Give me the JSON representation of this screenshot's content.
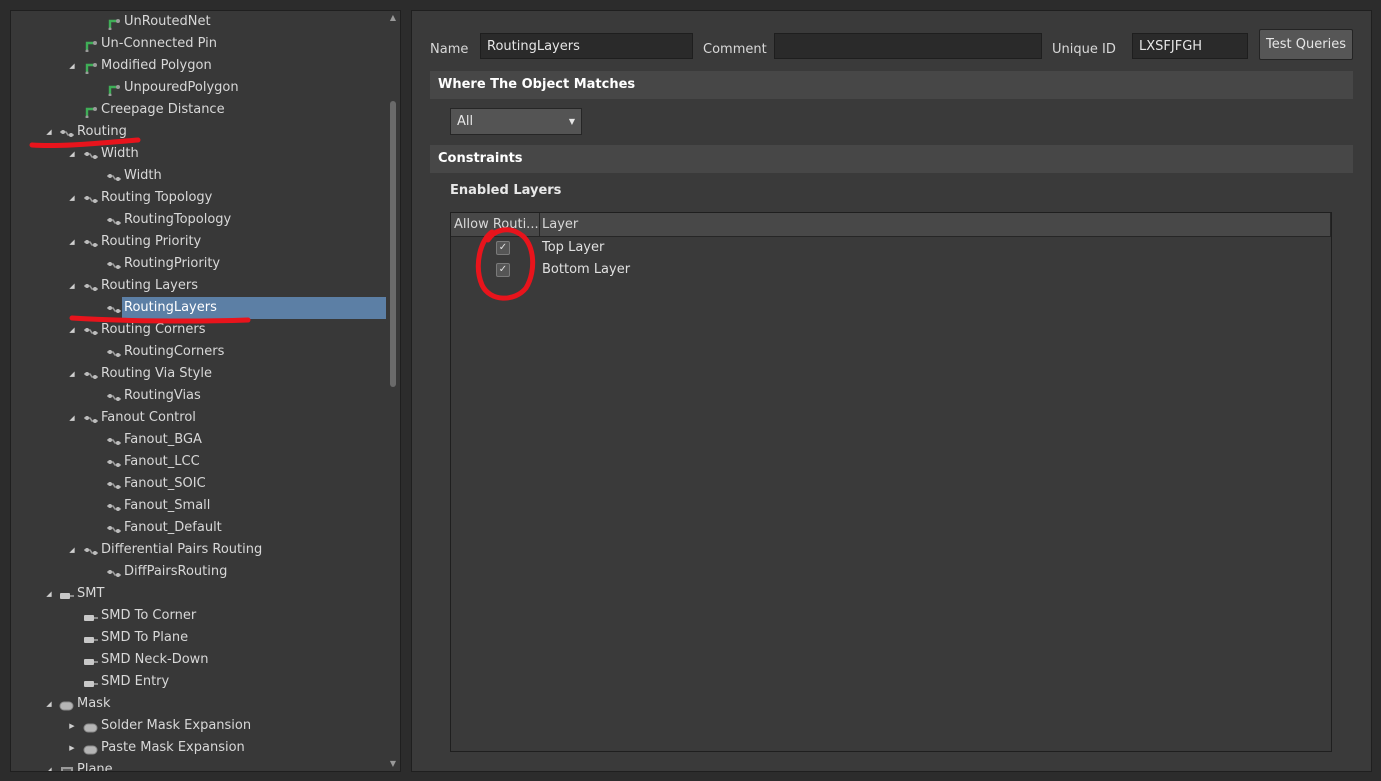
{
  "tree": {
    "items": [
      {
        "label": "UnRoutedNet",
        "depth": 3,
        "icon": "green-rule-icon",
        "arrow": ""
      },
      {
        "label": "Un-Connected Pin",
        "depth": 2,
        "icon": "green-rule-icon",
        "arrow": ""
      },
      {
        "label": "Modified Polygon",
        "depth": 2,
        "icon": "green-rule-icon",
        "arrow": "expanded"
      },
      {
        "label": "UnpouredPolygon",
        "depth": 3,
        "icon": "green-rule-icon",
        "arrow": ""
      },
      {
        "label": "Creepage Distance",
        "depth": 2,
        "icon": "green-rule-icon",
        "arrow": ""
      },
      {
        "label": "Routing",
        "depth": 1,
        "icon": "routing-rule-icon",
        "arrow": "expanded"
      },
      {
        "label": "Width",
        "depth": 2,
        "icon": "routing-rule-icon",
        "arrow": "expanded"
      },
      {
        "label": "Width",
        "depth": 3,
        "icon": "routing-rule-icon",
        "arrow": ""
      },
      {
        "label": "Routing Topology",
        "depth": 2,
        "icon": "routing-rule-icon",
        "arrow": "expanded"
      },
      {
        "label": "RoutingTopology",
        "depth": 3,
        "icon": "routing-rule-icon",
        "arrow": ""
      },
      {
        "label": "Routing Priority",
        "depth": 2,
        "icon": "routing-rule-icon",
        "arrow": "expanded"
      },
      {
        "label": "RoutingPriority",
        "depth": 3,
        "icon": "routing-rule-icon",
        "arrow": ""
      },
      {
        "label": "Routing Layers",
        "depth": 2,
        "icon": "routing-rule-icon",
        "arrow": "expanded"
      },
      {
        "label": "RoutingLayers",
        "depth": 3,
        "icon": "routing-rule-icon",
        "arrow": "",
        "selected": true
      },
      {
        "label": "Routing Corners",
        "depth": 2,
        "icon": "routing-rule-icon",
        "arrow": "expanded"
      },
      {
        "label": "RoutingCorners",
        "depth": 3,
        "icon": "routing-rule-icon",
        "arrow": ""
      },
      {
        "label": "Routing Via Style",
        "depth": 2,
        "icon": "routing-rule-icon",
        "arrow": "expanded"
      },
      {
        "label": "RoutingVias",
        "depth": 3,
        "icon": "routing-rule-icon",
        "arrow": ""
      },
      {
        "label": "Fanout Control",
        "depth": 2,
        "icon": "routing-rule-icon",
        "arrow": "expanded"
      },
      {
        "label": "Fanout_BGA",
        "depth": 3,
        "icon": "routing-rule-icon",
        "arrow": ""
      },
      {
        "label": "Fanout_LCC",
        "depth": 3,
        "icon": "routing-rule-icon",
        "arrow": ""
      },
      {
        "label": "Fanout_SOIC",
        "depth": 3,
        "icon": "routing-rule-icon",
        "arrow": ""
      },
      {
        "label": "Fanout_Small",
        "depth": 3,
        "icon": "routing-rule-icon",
        "arrow": ""
      },
      {
        "label": "Fanout_Default",
        "depth": 3,
        "icon": "routing-rule-icon",
        "arrow": ""
      },
      {
        "label": "Differential Pairs Routing",
        "depth": 2,
        "icon": "routing-rule-icon",
        "arrow": "expanded"
      },
      {
        "label": "DiffPairsRouting",
        "depth": 3,
        "icon": "routing-rule-icon",
        "arrow": ""
      },
      {
        "label": "SMT",
        "depth": 1,
        "icon": "smt-rule-icon",
        "arrow": "expanded"
      },
      {
        "label": "SMD To Corner",
        "depth": 2,
        "icon": "smt-rule-icon",
        "arrow": ""
      },
      {
        "label": "SMD To Plane",
        "depth": 2,
        "icon": "smt-rule-icon",
        "arrow": ""
      },
      {
        "label": "SMD Neck-Down",
        "depth": 2,
        "icon": "smt-rule-icon",
        "arrow": ""
      },
      {
        "label": "SMD Entry",
        "depth": 2,
        "icon": "smt-rule-icon",
        "arrow": ""
      },
      {
        "label": "Mask",
        "depth": 1,
        "icon": "mask-rule-icon",
        "arrow": "expanded"
      },
      {
        "label": "Solder Mask Expansion",
        "depth": 2,
        "icon": "mask-rule-icon",
        "arrow": "collapsed"
      },
      {
        "label": "Paste Mask Expansion",
        "depth": 2,
        "icon": "mask-rule-icon",
        "arrow": "collapsed"
      },
      {
        "label": "Plane",
        "depth": 1,
        "icon": "plane-rule-icon",
        "arrow": "expanded"
      }
    ]
  },
  "editor": {
    "name_label": "Name",
    "name_value": "RoutingLayers",
    "comment_label": "Comment",
    "comment_value": "",
    "unique_id_label": "Unique ID",
    "unique_id_value": "LXSFJFGH",
    "test_queries_label": "Test Queries",
    "where_header": "Where The Object Matches",
    "match_value": "All",
    "constraints_header": "Constraints",
    "enabled_layers_title": "Enabled Layers",
    "columns": [
      "Allow Routi...",
      "Layer"
    ],
    "layers": [
      {
        "name": "Top Layer",
        "allowed": true
      },
      {
        "name": "Bottom Layer",
        "allowed": true
      }
    ]
  },
  "colors": {
    "background": "#2c2c2c",
    "panel": "#383838",
    "selection": "#5c7fa5",
    "annotation": "#e8141c"
  }
}
